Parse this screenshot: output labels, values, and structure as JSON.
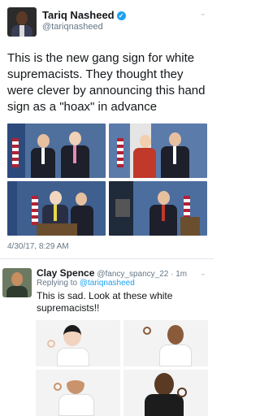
{
  "tweet": {
    "display_name": "Tariq Nasheed",
    "verified_icon": "verified-badge-icon",
    "handle": "@tariqnasheed",
    "menu_icon": "chevron-down-icon",
    "text": "This is the new gang sign for white supremacists. They thought they were clever by announcing this hand sign as a \"hoax\" in advance",
    "timestamp": "4/30/17, 8:29 AM"
  },
  "reply": {
    "display_name": "Clay Spence",
    "handle_time": "@fancy_spancy_22 · 1m",
    "menu_icon": "chevron-down-icon",
    "replying_prefix": "Replying to",
    "replying_handle": "@tariqnasheed",
    "text": "This is sad. Look at these white supremacists!!"
  },
  "colors": {
    "link": "#1da1f2",
    "muted": "#657786",
    "text": "#14171a",
    "divider": "#e1e8ed"
  }
}
